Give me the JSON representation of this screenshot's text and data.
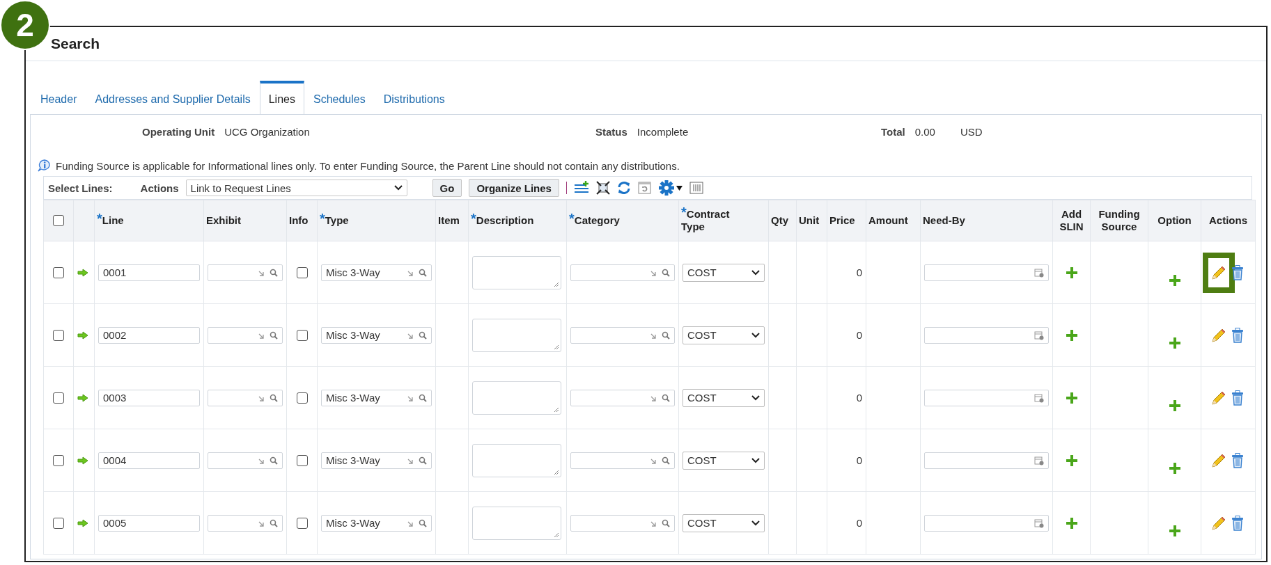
{
  "step_badge": "2",
  "window": {
    "title": "Search"
  },
  "tabs": [
    {
      "label": "Header",
      "selected": false
    },
    {
      "label": "Addresses and Supplier Details",
      "selected": false
    },
    {
      "label": "Lines",
      "selected": true
    },
    {
      "label": "Schedules",
      "selected": false
    },
    {
      "label": "Distributions",
      "selected": false
    }
  ],
  "summary": [
    {
      "label": "Operating Unit",
      "value": "UCG Organization"
    },
    {
      "label": "Status",
      "value": "Incomplete"
    },
    {
      "label": "Total",
      "value": "0.00",
      "currency": "USD"
    }
  ],
  "info_message": "Funding Source is applicable for Informational lines only. To enter Funding Source, the Parent Line should not contain any distributions.",
  "toolbar": {
    "select_label": "Select Lines:",
    "actions_label": "Actions",
    "actions_value": "Link to Request Lines",
    "buttons": [
      "Go",
      "Organize Lines"
    ]
  },
  "table": {
    "select_all_checked": false,
    "columns": [
      {
        "kind": "select"
      },
      {
        "kind": "blank"
      },
      {
        "label": "Line",
        "required_mark": "*"
      },
      {
        "label": "Exhibit"
      },
      {
        "label": "Info"
      },
      {
        "label": "Type",
        "required_mark": "*"
      },
      {
        "label": "Item"
      },
      {
        "label": "Description",
        "required_mark": "*"
      },
      {
        "label": "Category",
        "required_mark": "*"
      },
      {
        "label": "Contract Type",
        "required_mark": "*"
      },
      {
        "label": "Qty"
      },
      {
        "label": "Unit"
      },
      {
        "label": "Price"
      },
      {
        "label": "Amount"
      },
      {
        "label": "Need-By"
      },
      {
        "label": "Add SLIN"
      },
      {
        "label": "Funding Source"
      },
      {
        "label": "Option"
      },
      {
        "label": "Actions"
      }
    ],
    "rows": [
      {
        "checked": false,
        "line": "0001",
        "info_checked": false,
        "type": "Misc 3-Way",
        "contract_type": "COST",
        "price": "0",
        "edit_highlighted": true
      },
      {
        "checked": false,
        "line": "0002",
        "info_checked": false,
        "type": "Misc 3-Way",
        "contract_type": "COST",
        "price": "0",
        "edit_highlighted": false
      },
      {
        "checked": false,
        "line": "0003",
        "info_checked": false,
        "type": "Misc 3-Way",
        "contract_type": "COST",
        "price": "0",
        "edit_highlighted": false
      },
      {
        "checked": false,
        "line": "0004",
        "info_checked": false,
        "type": "Misc 3-Way",
        "contract_type": "COST",
        "price": "0",
        "edit_highlighted": false
      },
      {
        "checked": false,
        "line": "0005",
        "info_checked": false,
        "type": "Misc 3-Way",
        "contract_type": "COST",
        "price": "0",
        "edit_highlighted": false
      }
    ]
  }
}
